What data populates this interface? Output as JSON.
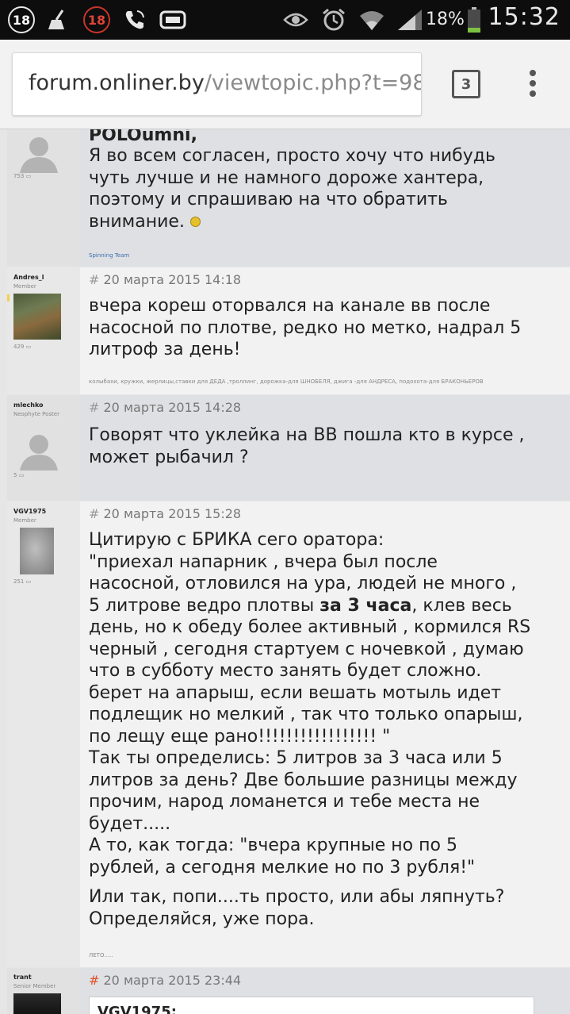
{
  "status_bar": {
    "notif_badge": "18",
    "notif_badge_red": "18",
    "battery": "18%",
    "time": "15:32"
  },
  "browser": {
    "url_main": "forum.onliner.by",
    "url_rest": "/viewtopic.php?t=98",
    "tab_count": "3"
  },
  "posts": [
    {
      "author": "",
      "rank": "",
      "post_count": "753",
      "date": "",
      "body_top": "POLOumni",
      "body": "Я во всем согласен, просто хочу что нибудь чуть лучше и не намного дороже хантера, поэтому и спрашиваю на что обратить внимание.",
      "signature": "Spinning Team"
    },
    {
      "author": "Andres_l",
      "rank": "Member",
      "post_count": "429",
      "date": "20 марта 2015 14:18",
      "body": "вчера кореш оторвался на канале вв после насосной по плотве, редко но метко, надрал 5 литроф за день!",
      "signature": "колыбахи, кружки, жерлицы,ставки для ДЕДА ,троллинг, дорожка-для ШНОБЕЛЯ, джига -для АНДРЕСА, подохота-для БРАКОНЬЕРОВ"
    },
    {
      "author": "mlechko",
      "rank": "Neophyte Poster",
      "post_count": "5",
      "date": "20 марта 2015 14:28",
      "body": "Говорят что уклейка на ВВ пошла кто в курсе , может рыбачил ?"
    },
    {
      "author": "VGV1975",
      "rank": "Member",
      "post_count": "251",
      "date": "20 марта 2015 15:28",
      "body_lines": [
        "Цитирую с БРИКА сего оратора:",
        "\"приехал напарник , вчера был после насосной, отловился на ура, людей не много , 5 литрове ведро плотвы ",
        "за 3 часа",
        ", клев весь день, но к обеду более активный , кормился RS черный , сегодня стартуем с ночевкой , думаю что в субботу место занять будет сложно. берет на апарыш, если вешать мотыль идет подлещик но мелкий , так что только опарыш, по лещу еще рано!!!!!!!!!!!!!!!!! \"",
        "Так ты определись: 5 литров за 3 часа или 5 литров за день? Две большие разницы между прочим, народ ломанется и тебе места не будет.....",
        "А то, как тогда: \"вчера крупные но по 5 рублей, а сегодня мелкие но по 3 рубля!\"",
        "Или так, попи....ть просто, или абы ляпнуть? Определяйся, уже пора."
      ],
      "signature": "ЛЕТО....."
    },
    {
      "author": "trant",
      "rank": "Senior Member",
      "date": "20 марта 2015 23:44",
      "quote_author": "VGV1975:"
    }
  ],
  "colors": {
    "hash_orange": "#e0522a",
    "signature_blue": "#3a6fb0"
  }
}
